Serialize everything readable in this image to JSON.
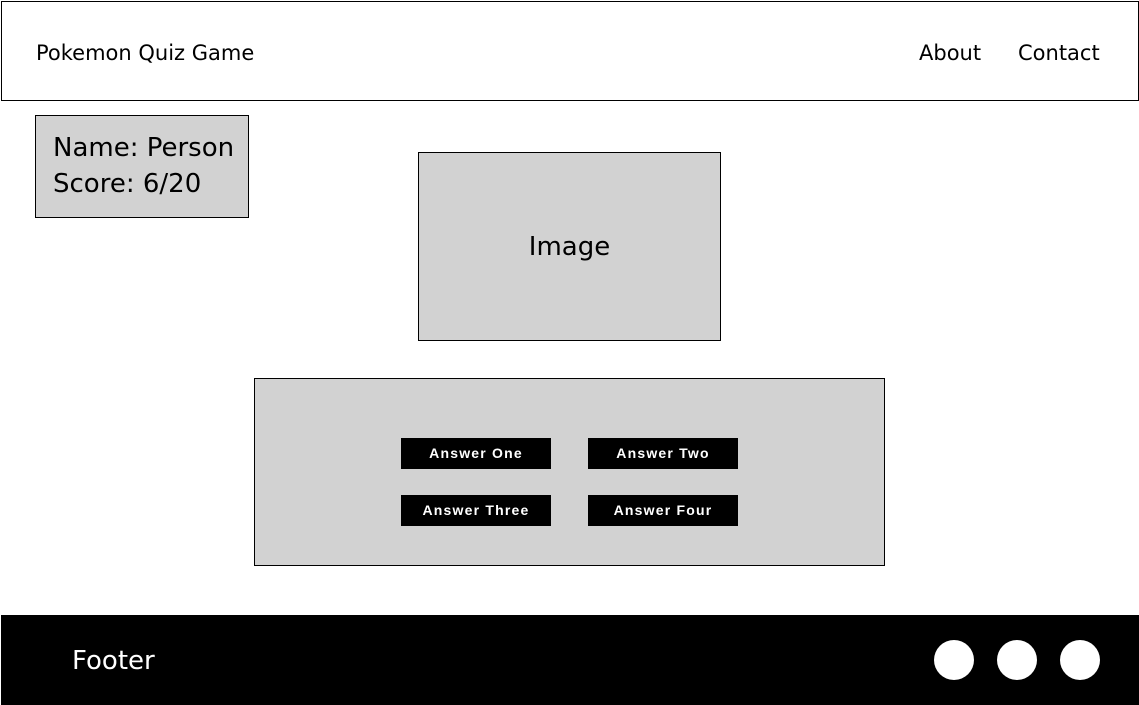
{
  "header": {
    "title": "Pokemon Quiz Game",
    "nav": [
      "About",
      "Contact"
    ]
  },
  "player": {
    "name_line": "Name: Person",
    "score_line": "Score: 6/20"
  },
  "question": {
    "image_label": "Image"
  },
  "answers": [
    "Answer One",
    "Answer Two",
    "Answer Three",
    "Answer Four"
  ],
  "footer": {
    "label": "Footer",
    "social_icons": [
      "social-icon-1",
      "social-icon-2",
      "social-icon-3"
    ]
  }
}
